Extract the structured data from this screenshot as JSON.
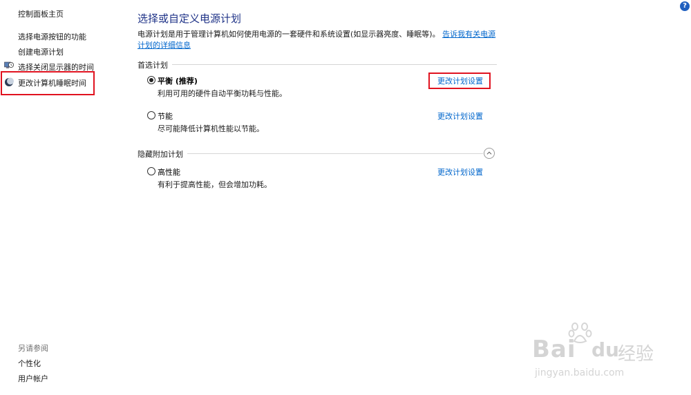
{
  "sidebar": {
    "home": "控制面板主页",
    "links": [
      "选择电源按钮的功能",
      "创建电源计划",
      "选择关闭显示器的时间",
      "更改计算机睡眠时间"
    ],
    "see_also_title": "另请参阅",
    "see_also": [
      "个性化",
      "用户帐户"
    ]
  },
  "main": {
    "title": "选择或自定义电源计划",
    "description": "电源计划是用于管理计算机如何使用电源的一套硬件和系统设置(如显示器亮度、睡眠等)。",
    "description_link": "告诉我有关电源计划的详细信息",
    "preferred_label": "首选计划",
    "hidden_label": "隐藏附加计划",
    "preferred_plans": [
      {
        "name": "平衡 (推荐)",
        "desc": "利用可用的硬件自动平衡功耗与性能。",
        "link": "更改计划设置",
        "selected": true
      },
      {
        "name": "节能",
        "desc": "尽可能降低计算机性能以节能。",
        "link": "更改计划设置",
        "selected": false
      }
    ],
    "hidden_plans": [
      {
        "name": "高性能",
        "desc": "有利于提高性能，但会增加功耗。",
        "link": "更改计划设置",
        "selected": false
      }
    ]
  },
  "help_icon": "?",
  "icons": {
    "monitor-clock": "monitor-clock-icon",
    "moon": "moon-icon",
    "help": "help-icon",
    "collapse": "chevron-up-icon"
  },
  "colors": {
    "title": "#1e3287",
    "link": "#0066cc",
    "highlight": "#e0121f"
  },
  "watermark": {
    "brand": "Bai",
    "brand2": "du",
    "cn": "经验",
    "url": "jingyan.baidu.com"
  }
}
